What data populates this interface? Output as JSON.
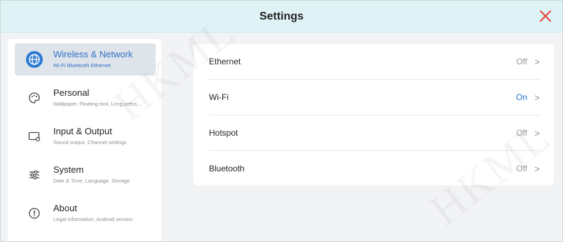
{
  "header": {
    "title": "Settings",
    "close_icon": "close-icon"
  },
  "colors": {
    "header_bg": "#dff3f7",
    "accent": "#2f7bd4",
    "close": "#e0443a",
    "on_status": "#1f6fd1",
    "off_status": "#999999"
  },
  "sidebar": {
    "items": [
      {
        "label": "Wireless & Network",
        "sub": "Wi-Fi Bluetooth Ethernet",
        "icon": "globe-icon",
        "active": true
      },
      {
        "label": "Personal",
        "sub": "Wallpaper, Floating tool, Long press...",
        "icon": "palette-icon",
        "active": false
      },
      {
        "label": "Input & Output",
        "sub": "Sound output, Channel settings",
        "icon": "monitor-icon",
        "active": false
      },
      {
        "label": "System",
        "sub": "Date & Time, Language, Storage",
        "icon": "sliders-icon",
        "active": false
      },
      {
        "label": "About",
        "sub": "Legal information, Android version",
        "icon": "info-icon",
        "active": false
      }
    ]
  },
  "main": {
    "rows": [
      {
        "label": "Ethernet",
        "status": "Off",
        "chevron": ">"
      },
      {
        "label": "Wi-Fi",
        "status": "On",
        "chevron": ">"
      },
      {
        "label": "Hotspot",
        "status": "Off",
        "chevron": ">"
      },
      {
        "label": "Bluetooth",
        "status": "Off",
        "chevron": ">"
      }
    ]
  },
  "watermark": {
    "text": "HKML"
  }
}
